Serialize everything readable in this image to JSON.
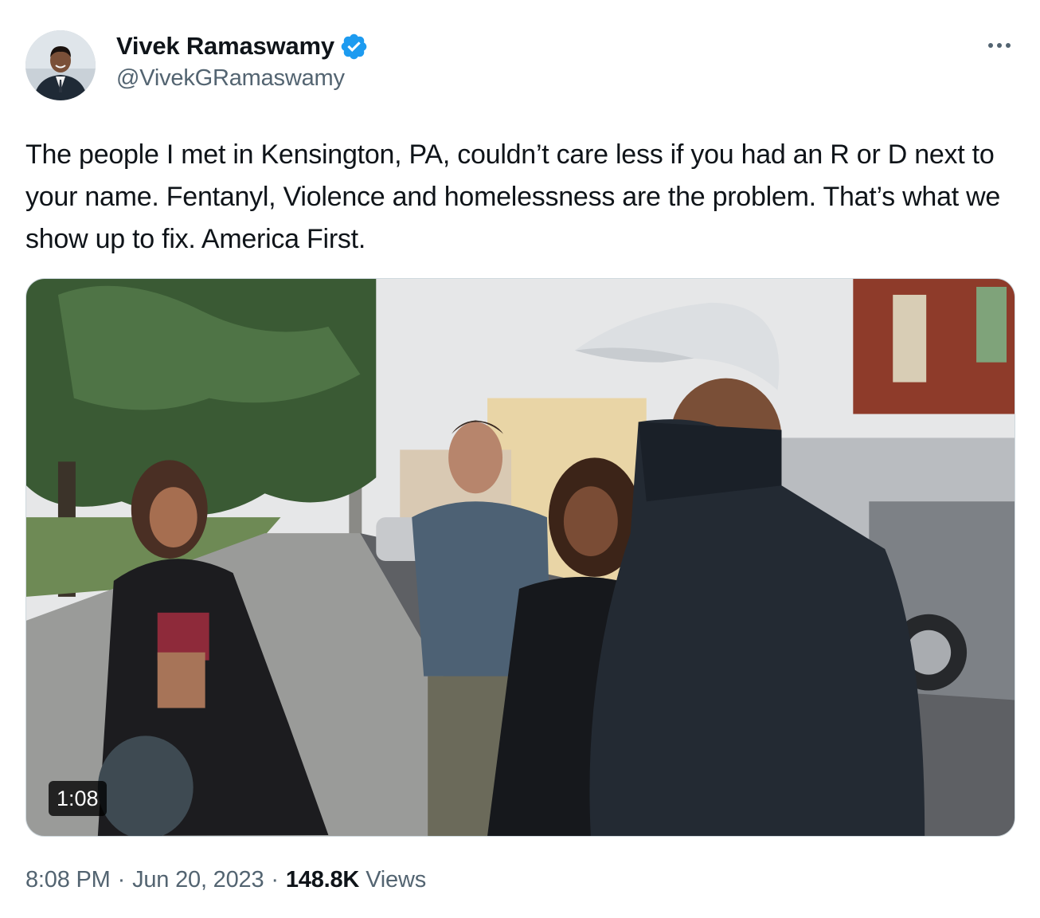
{
  "author": {
    "name": "Vivek Ramaswamy",
    "handle": "@VivekGRamaswamy",
    "verified": true,
    "badge_color": "#1d9bf0"
  },
  "tweet": {
    "text": "The people I met in Kensington, PA, couldn’t care less if you had an R or D next to your name. Fentanyl, Violence and homelessness are the problem. That’s what we show up to fix. America First."
  },
  "media": {
    "type": "video",
    "duration": "1:08"
  },
  "meta": {
    "time": "8:08 PM",
    "separator": "·",
    "date": "Jun 20, 2023",
    "views_count": "148.8K",
    "views_label": "Views"
  },
  "icons": {
    "more": "more-horizontal-icon",
    "verified": "verified-badge-icon"
  },
  "colors": {
    "text_primary": "#0f1419",
    "text_secondary": "#536471",
    "border": "#cfd9de"
  }
}
